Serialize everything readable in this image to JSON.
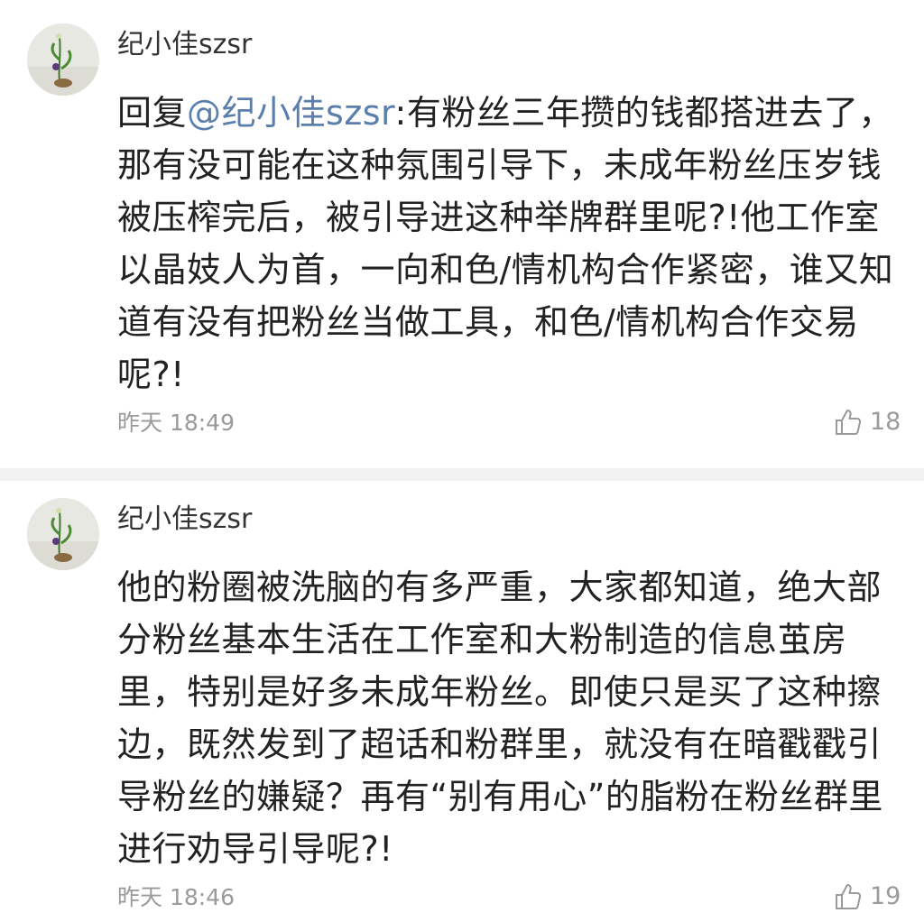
{
  "comments": [
    {
      "username": "纪小佳szsr",
      "reply_prefix": "回复",
      "mention": "@纪小佳szsr",
      "text": ":有粉丝三年攒的钱都搭进去了，那有没可能在这种氛围引导下，未成年粉丝压岁钱被压榨完后，被引导进这种举牌群里呢?!他工作室以晶妓人为首，一向和色/情机构合作紧密，谁又知道有没有把粉丝当做工具，和色/情机构合作交易呢?!",
      "time": "昨天 18:49",
      "likes": "18"
    },
    {
      "username": "纪小佳szsr",
      "text": "他的粉圈被洗脑的有多严重，大家都知道，绝大部分粉丝基本生活在工作室和大粉制造的信息茧房里，特别是好多未成年粉丝。即使只是买了这种擦边，既然发到了超话和粉群里，就没有在暗戳戳引导粉丝的嫌疑？再有“别有用心”的脂粉在粉丝群里进行劝导引导呢?!",
      "time": "昨天 18:46",
      "likes": "19"
    }
  ],
  "icons": {
    "like": "thumbs-up-icon",
    "avatar": "flower-vase-avatar"
  },
  "colors": {
    "mention": "#5b7fad",
    "meta": "#9a9a9a",
    "text": "#222222"
  }
}
